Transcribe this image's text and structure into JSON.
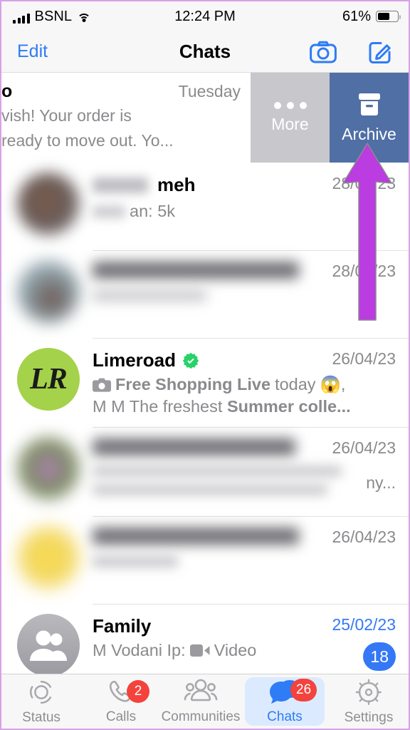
{
  "status_bar": {
    "carrier": "BSNL",
    "signal_icon": "signal-bars-icon",
    "wifi_icon": "wifi-icon",
    "time": "12:24 PM",
    "battery_percent": "61%",
    "battery_icon": "battery-icon",
    "battery_level": 61
  },
  "nav_bar": {
    "edit_label": "Edit",
    "title": "Chats",
    "camera_icon": "camera-icon",
    "compose_icon": "compose-icon"
  },
  "swiped_row": {
    "name_fragment": "o",
    "date": "Tuesday",
    "message_line1": "vish!  Your order is",
    "message_line2": "ready to move out.  Yo...",
    "actions": [
      {
        "label": "More",
        "icon": "ellipsis-icon",
        "color": "#c8c7cc"
      },
      {
        "label": "Archive",
        "icon": "archive-box-icon",
        "color": "#4f6fa5"
      }
    ]
  },
  "annotation": {
    "arrow_color": "#bb3ce0",
    "points_to": "Archive"
  },
  "chats": [
    {
      "id": "chat-meh",
      "name": "meh",
      "name_redacted": true,
      "verified": false,
      "message": "an: 5k",
      "message_redacted": true,
      "date": "28/04/23",
      "date_redacted": false,
      "avatar_type": "photo-blurred",
      "unread": null,
      "redacted": true
    },
    {
      "id": "chat-redacted-1",
      "name": "",
      "name_redacted": true,
      "verified": false,
      "message": "",
      "message_redacted": true,
      "date": "28/04/23",
      "avatar_type": "photo-blurred",
      "unread": null,
      "redacted": true
    },
    {
      "id": "chat-limeroad",
      "name": "Limeroad",
      "name_redacted": false,
      "verified": true,
      "message_icon": "camera-small-icon",
      "message_line1_bold": "Free Shopping Live",
      "message_line1_plain": "today",
      "message_line1_emoji": "😱,",
      "message_line2_plain_a": "M M The freshest",
      "message_line2_bold": "Summer colle...",
      "date": "26/04/23",
      "avatar_type": "initials",
      "avatar_initials": "LR",
      "avatar_color": "#a4d24a",
      "unread": null,
      "redacted": false
    },
    {
      "id": "chat-redacted-2",
      "name": "",
      "name_redacted": true,
      "message_tail": "ny...",
      "message_redacted": true,
      "date": "26/04/23",
      "avatar_type": "photo-blurred",
      "unread": null,
      "redacted": true
    },
    {
      "id": "chat-redacted-3",
      "name": "",
      "name_redacted": true,
      "message": "",
      "message_redacted": true,
      "date": "26/04/23",
      "avatar_type": "photo-blurred-yellow",
      "unread": null,
      "redacted": true
    },
    {
      "id": "chat-family",
      "name": "Family",
      "name_redacted": false,
      "verified": false,
      "message_sender": "M Vodani Ip:",
      "message_icon": "video-camera-icon",
      "message_body": "Video",
      "date": "25/02/23",
      "date_highlight": true,
      "avatar_type": "group",
      "unread": "18",
      "redacted": false
    }
  ],
  "tab_bar": {
    "items": [
      {
        "id": "tab-status",
        "label": "Status",
        "icon": "status-ring-icon",
        "badge": null,
        "active": false
      },
      {
        "id": "tab-calls",
        "label": "Calls",
        "icon": "phone-icon",
        "badge": "2",
        "active": false
      },
      {
        "id": "tab-communities",
        "label": "Communities",
        "icon": "communities-icon",
        "badge": null,
        "active": false
      },
      {
        "id": "tab-chats",
        "label": "Chats",
        "icon": "chat-bubbles-icon",
        "badge": "26",
        "active": true
      },
      {
        "id": "tab-settings",
        "label": "Settings",
        "icon": "gear-icon",
        "badge": null,
        "active": false
      }
    ]
  },
  "colors": {
    "ios_blue": "#2e7cf6",
    "badge_red": "#f4423c",
    "badge_blue": "#3478f6",
    "archive_blue": "#4f6fa5",
    "more_gray": "#c8c7cc",
    "verified_green": "#25d366",
    "arrow_purple": "#bb3ce0"
  }
}
